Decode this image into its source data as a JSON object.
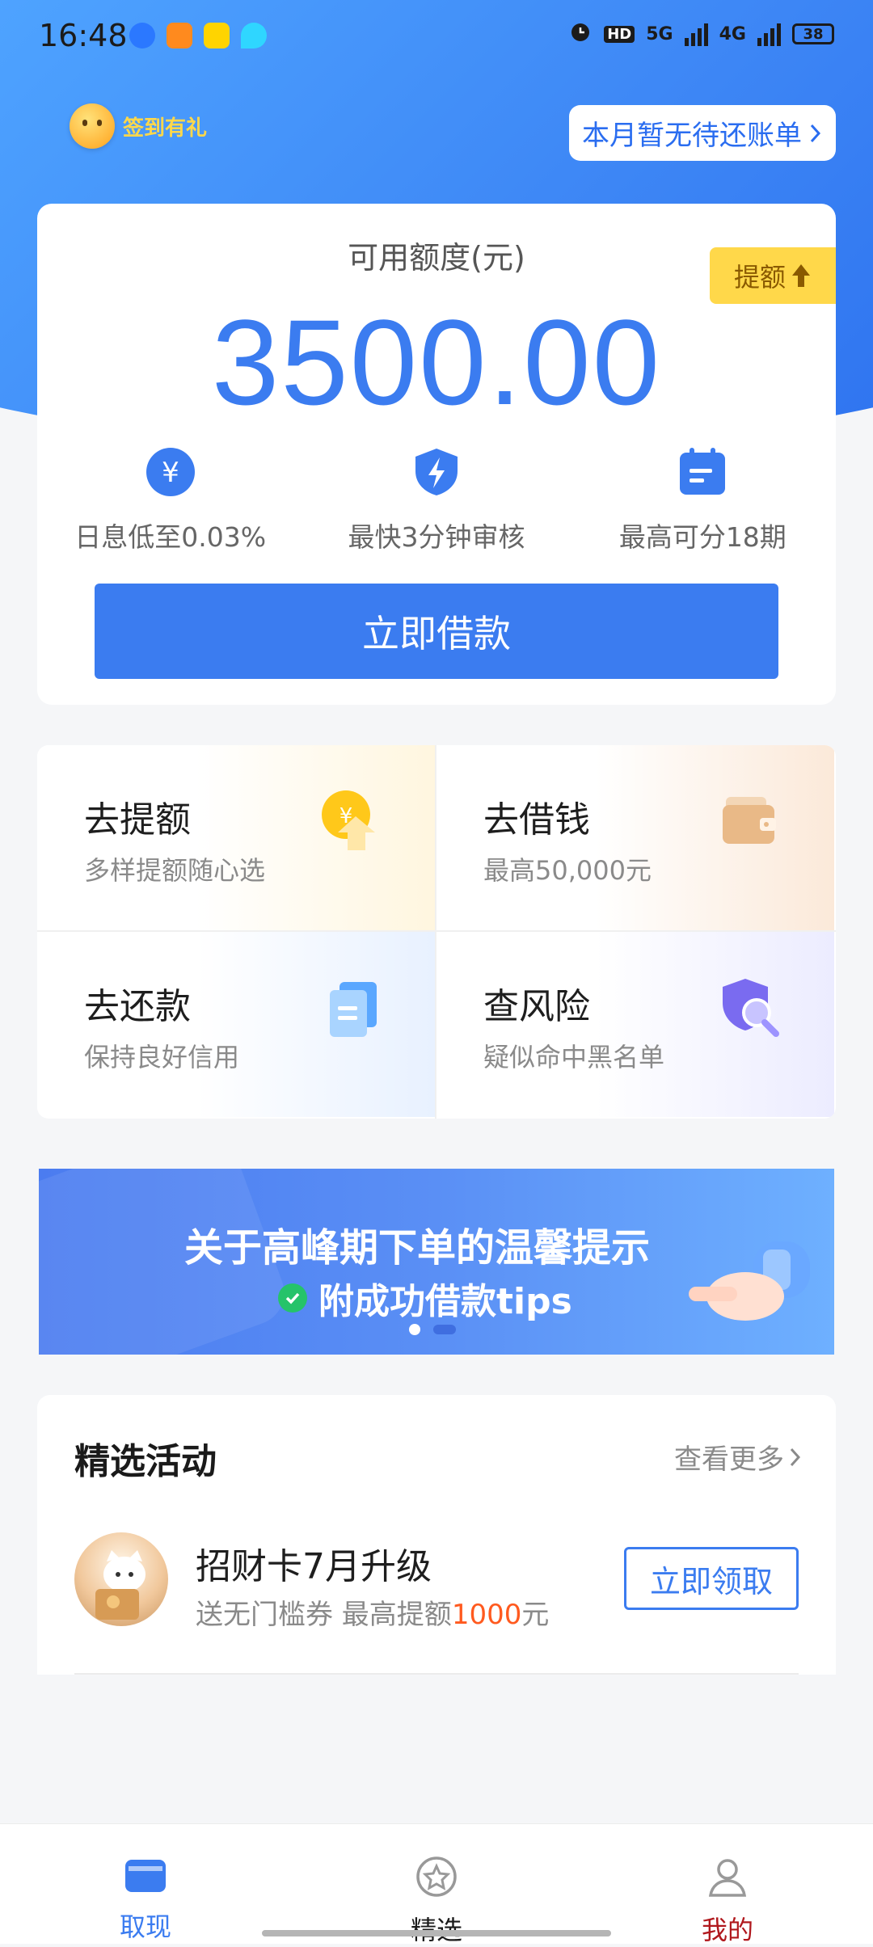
{
  "status_bar": {
    "time": "16:48",
    "battery": "38",
    "network1": "5G",
    "network2": "4G",
    "hd": "HD"
  },
  "header": {
    "signin_label": "签到有礼",
    "bill_status": "本月暂无待还账单"
  },
  "credit": {
    "label": "可用额度(元)",
    "amount": "3500.00",
    "raise_label": "提额",
    "features": [
      {
        "icon": "yen-icon",
        "text": "日息低至0.03%"
      },
      {
        "icon": "shield-lightning-icon",
        "text": "最快3分钟审核"
      },
      {
        "icon": "calendar-icon",
        "text": "最高可分18期"
      }
    ],
    "borrow_button": "立即借款"
  },
  "grid": [
    {
      "title": "去提额",
      "subtitle": "多样提额随心选",
      "icon": "coin-up-icon"
    },
    {
      "title": "去借钱",
      "subtitle": "最高50,000元",
      "icon": "wallet-icon"
    },
    {
      "title": "去还款",
      "subtitle": "保持良好信用",
      "icon": "document-icon"
    },
    {
      "title": "查风险",
      "subtitle": "疑似命中黑名单",
      "icon": "shield-search-icon"
    }
  ],
  "banner": {
    "line1": "关于高峰期下单的温馨提示",
    "line2": "附成功借款tips"
  },
  "activities": {
    "title": "精选活动",
    "more": "查看更多",
    "item": {
      "name": "招财卡7月升级",
      "desc_prefix": "送无门槛券  最高提额",
      "desc_highlight": "1000",
      "desc_suffix": "元",
      "button": "立即领取"
    }
  },
  "tabbar": {
    "tabs": [
      {
        "label": "取现",
        "active": true,
        "color": "#3b7cf0"
      },
      {
        "label": "精选",
        "active": false,
        "color": "#1a1a1a"
      },
      {
        "label": "我的",
        "active": false,
        "color": "#b0181d"
      }
    ]
  },
  "colors": {
    "primary": "#3b7cf0",
    "accent_yellow": "#ffd84a",
    "highlight": "#ff5a1f"
  }
}
